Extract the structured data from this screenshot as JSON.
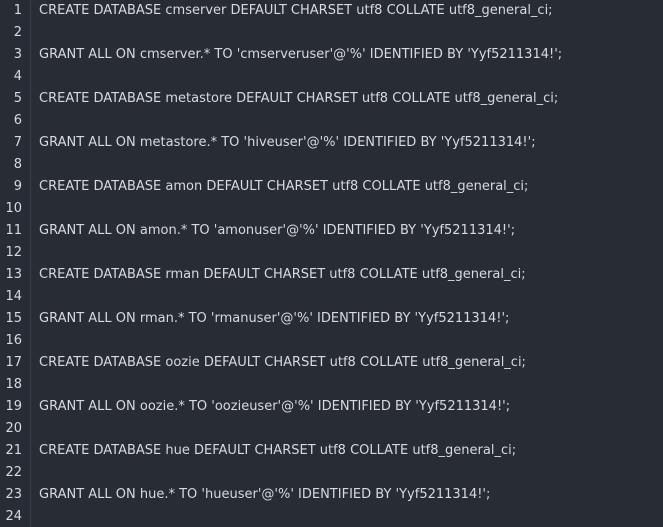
{
  "editor": {
    "lines": [
      {
        "number": "1",
        "text": "CREATE DATABASE cmserver DEFAULT CHARSET utf8 COLLATE utf8_general_ci;"
      },
      {
        "number": "2",
        "text": ""
      },
      {
        "number": "3",
        "text": "GRANT ALL ON cmserver.* TO 'cmserveruser'@'%' IDENTIFIED BY 'Yyf5211314!';"
      },
      {
        "number": "4",
        "text": ""
      },
      {
        "number": "5",
        "text": "CREATE DATABASE metastore DEFAULT CHARSET utf8 COLLATE utf8_general_ci;"
      },
      {
        "number": "6",
        "text": ""
      },
      {
        "number": "7",
        "text": "GRANT ALL ON metastore.* TO 'hiveuser'@'%' IDENTIFIED BY 'Yyf5211314!';"
      },
      {
        "number": "8",
        "text": ""
      },
      {
        "number": "9",
        "text": "CREATE DATABASE amon DEFAULT CHARSET utf8 COLLATE utf8_general_ci;"
      },
      {
        "number": "10",
        "text": ""
      },
      {
        "number": "11",
        "text": "GRANT ALL ON amon.* TO 'amonuser'@'%' IDENTIFIED BY 'Yyf5211314!';"
      },
      {
        "number": "12",
        "text": ""
      },
      {
        "number": "13",
        "text": "CREATE DATABASE rman DEFAULT CHARSET utf8 COLLATE utf8_general_ci;"
      },
      {
        "number": "14",
        "text": ""
      },
      {
        "number": "15",
        "text": "GRANT ALL ON rman.* TO 'rmanuser'@'%' IDENTIFIED BY 'Yyf5211314!';"
      },
      {
        "number": "16",
        "text": ""
      },
      {
        "number": "17",
        "text": "CREATE DATABASE oozie DEFAULT CHARSET utf8 COLLATE utf8_general_ci;"
      },
      {
        "number": "18",
        "text": ""
      },
      {
        "number": "19",
        "text": "GRANT ALL ON oozie.* TO 'oozieuser'@'%' IDENTIFIED BY 'Yyf5211314!';"
      },
      {
        "number": "20",
        "text": ""
      },
      {
        "number": "21",
        "text": "CREATE DATABASE hue DEFAULT CHARSET utf8 COLLATE utf8_general_ci;"
      },
      {
        "number": "22",
        "text": ""
      },
      {
        "number": "23",
        "text": "GRANT ALL ON hue.* TO 'hueuser'@'%' IDENTIFIED BY 'Yyf5211314!';"
      },
      {
        "number": "24",
        "text": ""
      }
    ]
  }
}
